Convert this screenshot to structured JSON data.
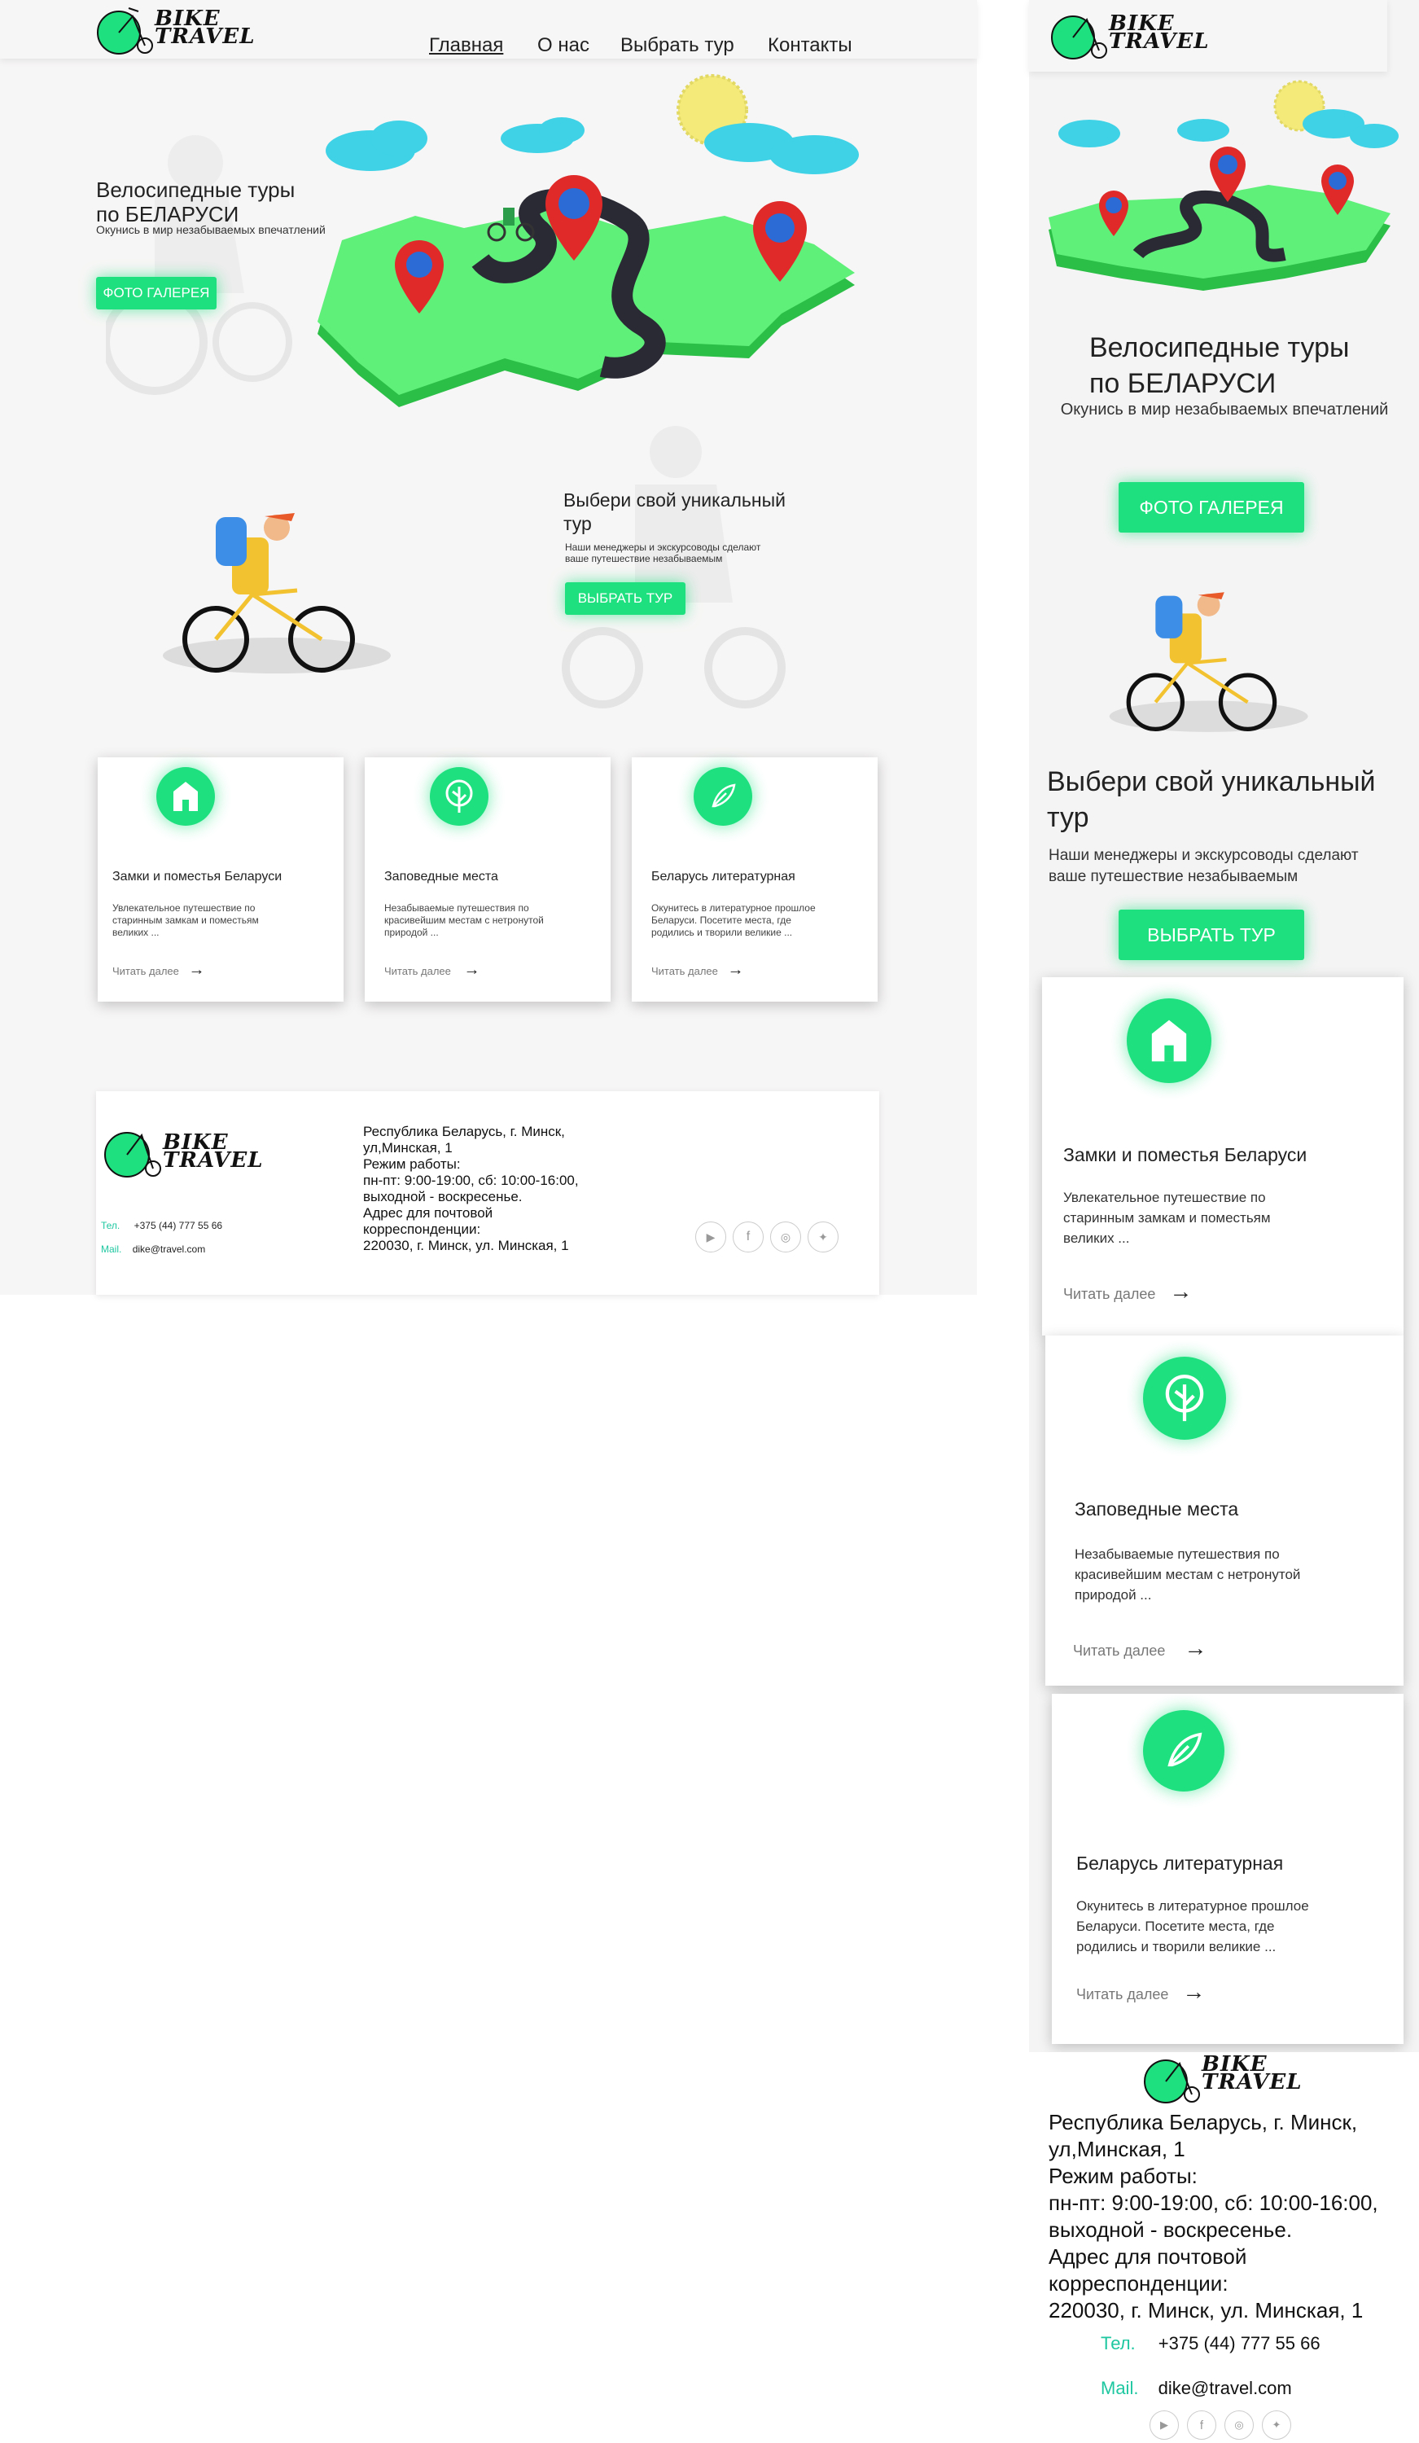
{
  "brand": {
    "line1": "BIKE",
    "line2": "TRAVEL"
  },
  "nav": [
    {
      "label": "Главная",
      "active": true
    },
    {
      "label": "О нас",
      "active": false
    },
    {
      "label": "Выбрать тур",
      "active": false
    },
    {
      "label": "Контакты",
      "active": false
    }
  ],
  "hero": {
    "title_line1": "Велосипедные туры",
    "title_line2": "по БЕЛАРУСИ",
    "subtitle": "Окунись в мир незабываемых впечатлений",
    "button": "ФОТО ГАЛЕРЕЯ"
  },
  "choose": {
    "title_line1": "Выбери свой уникальный",
    "title_line2": "тур",
    "text_line1": "Наши менеджеры и экскурсоводы сделают",
    "text_line2": "ваше путешествие незабываемым",
    "button": "ВЫБРАТЬ ТУР"
  },
  "cards": [
    {
      "icon": "house-icon",
      "title": "Замки и поместья Беларуси",
      "text_l1": "Увлекательное путешествие по",
      "text_l2": "старинным замкам и поместьям",
      "text_l3": "великих ...",
      "more": "Читать далее"
    },
    {
      "icon": "tree-icon",
      "title": "Заповедные места",
      "text_l1": "Незабываемые путешествия по",
      "text_l2": "красивейшим местам с нетронутой",
      "text_l3": "природой ...",
      "more": "Читать далее"
    },
    {
      "icon": "feather-icon",
      "title": "Беларусь литературная",
      "text_l1": "Окунитесь в литературное прошлое",
      "text_l2": "Беларуси. Посетите места, где",
      "text_l3": "родились и творили великие ...",
      "more": "Читать далее"
    }
  ],
  "footer": {
    "address_lines": [
      "Республика Беларусь, г. Минск,",
      "ул,Минская, 1",
      "Режим работы:",
      "пн-пт: 9:00-19:00, сб: 10:00-16:00,",
      "выходной - воскресенье.",
      "Адрес для почтовой",
      "корреспонденции:",
      "220030, г. Минск, ул. Минская, 1"
    ],
    "phone_label": "Тел.",
    "phone": "+375 (44) 777 55 66",
    "mail_label": "Mail.",
    "mail": "dike@travel.com",
    "socials": [
      "youtube-icon",
      "facebook-icon",
      "instagram-icon",
      "twitter-icon"
    ]
  },
  "colors": {
    "accent": "#1ee07f",
    "pin": "#e02a2a",
    "map": "#5ff07a",
    "cloud": "#3fd2e6",
    "sun": "#f3ea7a"
  }
}
